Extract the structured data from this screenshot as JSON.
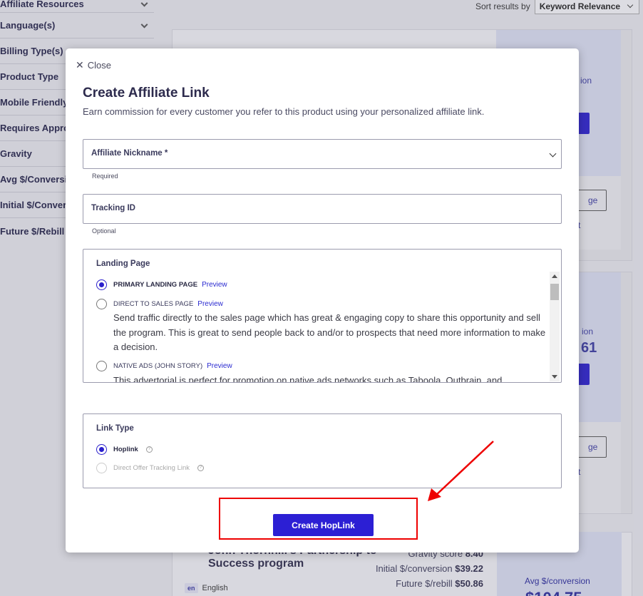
{
  "filters": [
    {
      "label": "Affiliate Resources"
    },
    {
      "label": "Language(s)"
    },
    {
      "label": "Billing Type(s)"
    },
    {
      "label": "Product Type"
    },
    {
      "label": "Mobile Friendly"
    },
    {
      "label": "Requires Appro"
    },
    {
      "label": "Gravity"
    },
    {
      "label": "Avg $/Conversi"
    },
    {
      "label": "Initial $/Conver"
    },
    {
      "label": "Future $/Rebill"
    }
  ],
  "sort": {
    "label": "Sort results by",
    "value": "Keyword Relevance"
  },
  "card3": {
    "title": "John Thornhill's Partnership to Success program",
    "gravity_label": "Gravity score",
    "gravity": "8.40",
    "initial_label": "Initial $/conversion",
    "initial": "$39.22",
    "future_label": "Future $/rebill",
    "future": "$50.86",
    "lang_code": "en",
    "lang": "English",
    "avg_label": "Avg $/conversion",
    "avg_value": "$104.75"
  },
  "bg_text": {
    "c1": "ion",
    "c2": "ge",
    "c3": "t",
    "c4": "ion",
    "c5": "61",
    "c6": "ge",
    "c7": "t"
  },
  "modal": {
    "close": "Close",
    "title": "Create Affiliate Link",
    "subtitle": "Earn commission for every customer you refer to this product using your personalized affiliate link.",
    "nickname_label": "Affiliate Nickname *",
    "nickname_hint": "Required",
    "tracking_label": "Tracking ID",
    "tracking_hint": "Optional",
    "landing_label": "Landing Page",
    "landing_options": [
      {
        "label": "PRIMARY LANDING PAGE",
        "preview": "Preview",
        "selected": true
      },
      {
        "label": "DIRECT TO SALES PAGE",
        "preview": "Preview",
        "selected": false,
        "description": "Send traffic directly to the sales page which has great & engaging copy to share this opportunity and sell the program. This is great to send people back to and/or to prospects that need more information to make a decision."
      },
      {
        "label": "NATIVE ADS (JOHN STORY)",
        "preview": "Preview",
        "selected": false,
        "description": "This advertorial is perfect for promotion on native ads networks such as Taboola, Outbrain, and"
      }
    ],
    "linktype_label": "Link Type",
    "linktype_options": [
      {
        "label": "Hoplink",
        "selected": true
      },
      {
        "label": "Direct Offer Tracking Link",
        "selected": false,
        "disabled": true
      }
    ],
    "submit": "Create HopLink"
  },
  "colors": {
    "accent": "#2c1fd4",
    "highlight": "#ee0000"
  }
}
